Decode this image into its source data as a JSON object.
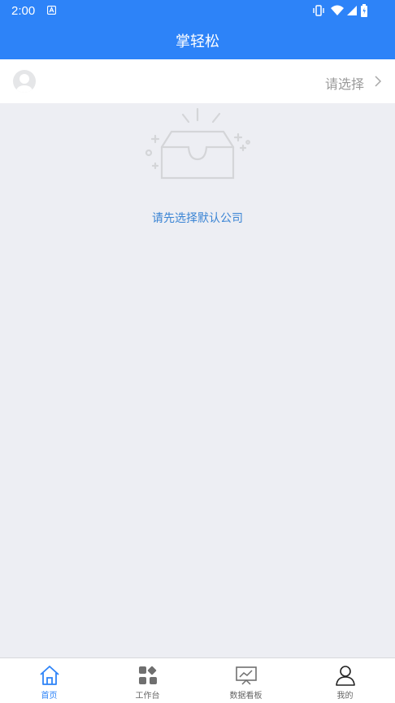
{
  "status_bar": {
    "time": "2:00"
  },
  "header": {
    "title": "掌轻松"
  },
  "company_selector": {
    "placeholder": "请选择"
  },
  "empty_state": {
    "message": "请先选择默认公司"
  },
  "tabs": [
    {
      "label": "首页",
      "icon": "home-icon",
      "active": true
    },
    {
      "label": "工作台",
      "icon": "apps-grid-icon",
      "active": false
    },
    {
      "label": "数据看板",
      "icon": "dashboard-chart-icon",
      "active": false
    },
    {
      "label": "我的",
      "icon": "person-icon",
      "active": false
    }
  ],
  "colors": {
    "brand_blue": "#2d83f8",
    "background": "#edeef3",
    "link_text": "#3a84d4"
  }
}
